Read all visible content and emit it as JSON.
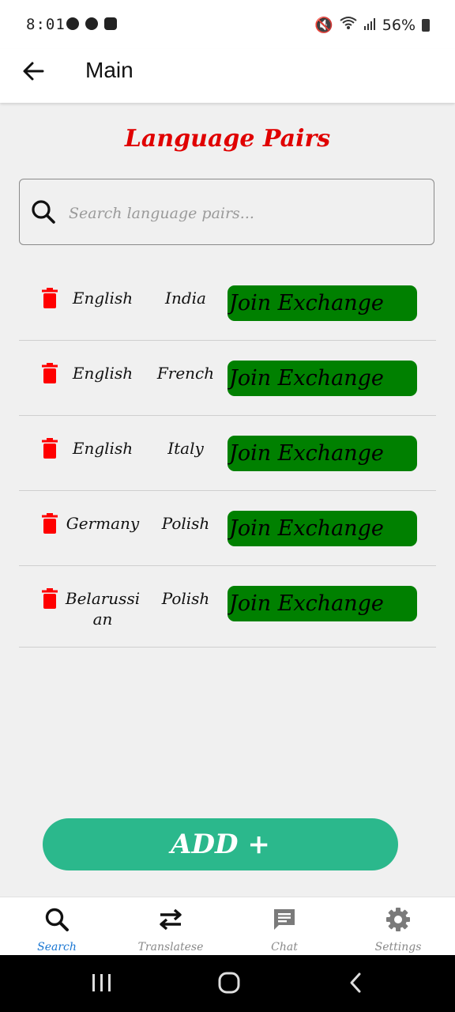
{
  "status_bar": {
    "time": "8:01",
    "battery": "56%"
  },
  "app_bar": {
    "title": "Main"
  },
  "page": {
    "heading": "Language Pairs",
    "search_placeholder": "Search language pairs..."
  },
  "pairs": [
    {
      "from": "English",
      "to": "India",
      "action": "Join Exchange"
    },
    {
      "from": "English",
      "to": "French",
      "action": "Join Exchange"
    },
    {
      "from": "English",
      "to": "Italy",
      "action": "Join Exchange"
    },
    {
      "from": "Germany",
      "to": "Polish",
      "action": "Join Exchange"
    },
    {
      "from": "Belarussian",
      "to": "Polish",
      "action": "Join Exchange"
    }
  ],
  "add_button": "ADD +",
  "bottom_nav": [
    {
      "label": "Search",
      "icon": "search-icon",
      "active": true
    },
    {
      "label": "Translatese",
      "icon": "swap-arrows-icon",
      "active": false
    },
    {
      "label": "Chat",
      "icon": "chat-icon",
      "active": false
    },
    {
      "label": "Settings",
      "icon": "gear-icon",
      "active": false
    }
  ],
  "colors": {
    "heading": "#e00000",
    "join_button": "#008000",
    "add_button": "#2bb88c",
    "delete_icon": "#ff0000",
    "nav_active": "#1976d2"
  }
}
